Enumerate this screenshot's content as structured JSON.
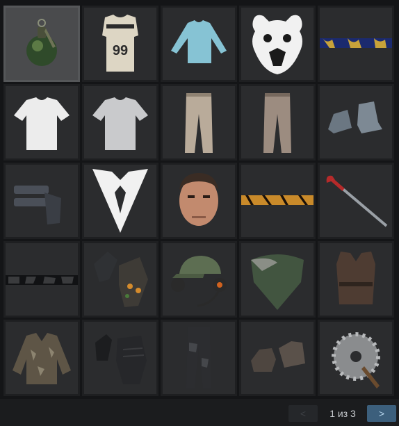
{
  "inventory": {
    "rows": [
      [
        {
          "icon": "grenade-icon",
          "selected": true
        },
        {
          "icon": "jersey-icon",
          "text": "99"
        },
        {
          "icon": "long-sleeve-shirt-icon"
        },
        {
          "icon": "bear-logo-icon"
        },
        {
          "icon": "striped-skin-icon"
        }
      ],
      [
        {
          "icon": "white-tshirt-icon"
        },
        {
          "icon": "grey-tshirt-icon"
        },
        {
          "icon": "cargo-pants-icon"
        },
        {
          "icon": "cargo-pants-icon"
        },
        {
          "icon": "boots-icon"
        }
      ],
      [
        {
          "icon": "holster-icon"
        },
        {
          "icon": "emblem-icon"
        },
        {
          "icon": "face-icon"
        },
        {
          "icon": "tiger-stripe-skin-icon"
        },
        {
          "icon": "crowbar-icon"
        }
      ],
      [
        {
          "icon": "camo-strip-skin-icon"
        },
        {
          "icon": "gloves-icon"
        },
        {
          "icon": "headset-cap-icon"
        },
        {
          "icon": "bandana-mask-icon"
        },
        {
          "icon": "vest-icon"
        }
      ],
      [
        {
          "icon": "jacket-icon"
        },
        {
          "icon": "fingerless-gloves-icon"
        },
        {
          "icon": "dark-pants-icon"
        },
        {
          "icon": "shoes-icon"
        },
        {
          "icon": "sawblade-icon"
        }
      ]
    ]
  },
  "pagination": {
    "prev_label": "<",
    "next_label": ">",
    "page_text": "1 из 3"
  }
}
